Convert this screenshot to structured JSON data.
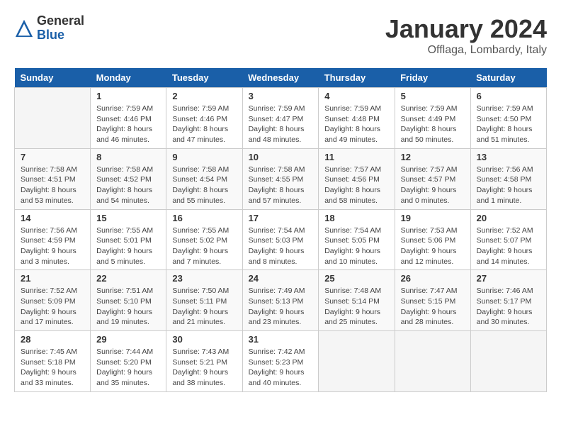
{
  "logo": {
    "general": "General",
    "blue": "Blue"
  },
  "header": {
    "month": "January 2024",
    "location": "Offlaga, Lombardy, Italy"
  },
  "weekdays": [
    "Sunday",
    "Monday",
    "Tuesday",
    "Wednesday",
    "Thursday",
    "Friday",
    "Saturday"
  ],
  "weeks": [
    [
      {
        "day": "",
        "info": ""
      },
      {
        "day": "1",
        "info": "Sunrise: 7:59 AM\nSunset: 4:46 PM\nDaylight: 8 hours and 46 minutes."
      },
      {
        "day": "2",
        "info": "Sunrise: 7:59 AM\nSunset: 4:46 PM\nDaylight: 8 hours and 47 minutes."
      },
      {
        "day": "3",
        "info": "Sunrise: 7:59 AM\nSunset: 4:47 PM\nDaylight: 8 hours and 48 minutes."
      },
      {
        "day": "4",
        "info": "Sunrise: 7:59 AM\nSunset: 4:48 PM\nDaylight: 8 hours and 49 minutes."
      },
      {
        "day": "5",
        "info": "Sunrise: 7:59 AM\nSunset: 4:49 PM\nDaylight: 8 hours and 50 minutes."
      },
      {
        "day": "6",
        "info": "Sunrise: 7:59 AM\nSunset: 4:50 PM\nDaylight: 8 hours and 51 minutes."
      }
    ],
    [
      {
        "day": "7",
        "info": "Sunrise: 7:58 AM\nSunset: 4:51 PM\nDaylight: 8 hours and 53 minutes."
      },
      {
        "day": "8",
        "info": "Sunrise: 7:58 AM\nSunset: 4:52 PM\nDaylight: 8 hours and 54 minutes."
      },
      {
        "day": "9",
        "info": "Sunrise: 7:58 AM\nSunset: 4:54 PM\nDaylight: 8 hours and 55 minutes."
      },
      {
        "day": "10",
        "info": "Sunrise: 7:58 AM\nSunset: 4:55 PM\nDaylight: 8 hours and 57 minutes."
      },
      {
        "day": "11",
        "info": "Sunrise: 7:57 AM\nSunset: 4:56 PM\nDaylight: 8 hours and 58 minutes."
      },
      {
        "day": "12",
        "info": "Sunrise: 7:57 AM\nSunset: 4:57 PM\nDaylight: 9 hours and 0 minutes."
      },
      {
        "day": "13",
        "info": "Sunrise: 7:56 AM\nSunset: 4:58 PM\nDaylight: 9 hours and 1 minute."
      }
    ],
    [
      {
        "day": "14",
        "info": "Sunrise: 7:56 AM\nSunset: 4:59 PM\nDaylight: 9 hours and 3 minutes."
      },
      {
        "day": "15",
        "info": "Sunrise: 7:55 AM\nSunset: 5:01 PM\nDaylight: 9 hours and 5 minutes."
      },
      {
        "day": "16",
        "info": "Sunrise: 7:55 AM\nSunset: 5:02 PM\nDaylight: 9 hours and 7 minutes."
      },
      {
        "day": "17",
        "info": "Sunrise: 7:54 AM\nSunset: 5:03 PM\nDaylight: 9 hours and 8 minutes."
      },
      {
        "day": "18",
        "info": "Sunrise: 7:54 AM\nSunset: 5:05 PM\nDaylight: 9 hours and 10 minutes."
      },
      {
        "day": "19",
        "info": "Sunrise: 7:53 AM\nSunset: 5:06 PM\nDaylight: 9 hours and 12 minutes."
      },
      {
        "day": "20",
        "info": "Sunrise: 7:52 AM\nSunset: 5:07 PM\nDaylight: 9 hours and 14 minutes."
      }
    ],
    [
      {
        "day": "21",
        "info": "Sunrise: 7:52 AM\nSunset: 5:09 PM\nDaylight: 9 hours and 17 minutes."
      },
      {
        "day": "22",
        "info": "Sunrise: 7:51 AM\nSunset: 5:10 PM\nDaylight: 9 hours and 19 minutes."
      },
      {
        "day": "23",
        "info": "Sunrise: 7:50 AM\nSunset: 5:11 PM\nDaylight: 9 hours and 21 minutes."
      },
      {
        "day": "24",
        "info": "Sunrise: 7:49 AM\nSunset: 5:13 PM\nDaylight: 9 hours and 23 minutes."
      },
      {
        "day": "25",
        "info": "Sunrise: 7:48 AM\nSunset: 5:14 PM\nDaylight: 9 hours and 25 minutes."
      },
      {
        "day": "26",
        "info": "Sunrise: 7:47 AM\nSunset: 5:15 PM\nDaylight: 9 hours and 28 minutes."
      },
      {
        "day": "27",
        "info": "Sunrise: 7:46 AM\nSunset: 5:17 PM\nDaylight: 9 hours and 30 minutes."
      }
    ],
    [
      {
        "day": "28",
        "info": "Sunrise: 7:45 AM\nSunset: 5:18 PM\nDaylight: 9 hours and 33 minutes."
      },
      {
        "day": "29",
        "info": "Sunrise: 7:44 AM\nSunset: 5:20 PM\nDaylight: 9 hours and 35 minutes."
      },
      {
        "day": "30",
        "info": "Sunrise: 7:43 AM\nSunset: 5:21 PM\nDaylight: 9 hours and 38 minutes."
      },
      {
        "day": "31",
        "info": "Sunrise: 7:42 AM\nSunset: 5:23 PM\nDaylight: 9 hours and 40 minutes."
      },
      {
        "day": "",
        "info": ""
      },
      {
        "day": "",
        "info": ""
      },
      {
        "day": "",
        "info": ""
      }
    ]
  ]
}
